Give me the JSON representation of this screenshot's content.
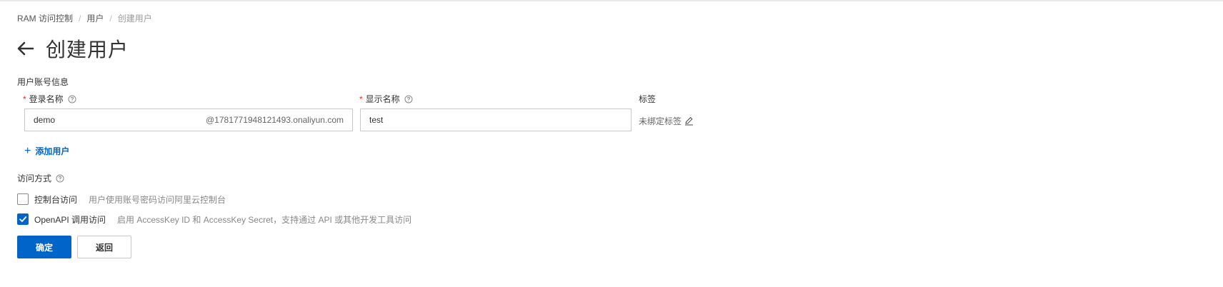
{
  "breadcrumb": {
    "items": [
      "RAM 访问控制",
      "用户",
      "创建用户"
    ],
    "separator": "/"
  },
  "header": {
    "back_icon": "arrow-left-icon",
    "title": "创建用户"
  },
  "form": {
    "section_title": "用户账号信息",
    "login_name": {
      "label": "登录名称",
      "required_mark": "*",
      "value": "demo",
      "suffix": "@1781771948121493.onaliyun.com"
    },
    "display_name": {
      "label": "显示名称",
      "required_mark": "*",
      "value": "test"
    },
    "tags": {
      "label": "标签",
      "value": "未绑定标签",
      "edit_icon": "pencil-icon"
    },
    "add_user": {
      "plus": "+",
      "label": "添加用户"
    }
  },
  "access": {
    "label": "访问方式",
    "options": [
      {
        "label": "控制台访问",
        "description": "用户使用账号密码访问阿里云控制台",
        "checked": false
      },
      {
        "label": "OpenAPI 调用访问",
        "description": "启用 AccessKey ID 和 AccessKey Secret，支持通过 API 或其他开发工具访问",
        "checked": true
      }
    ]
  },
  "buttons": {
    "confirm": "确定",
    "back": "返回"
  },
  "colors": {
    "primary": "#0064c8",
    "required": "#d93026",
    "border": "#c8c8c8"
  }
}
